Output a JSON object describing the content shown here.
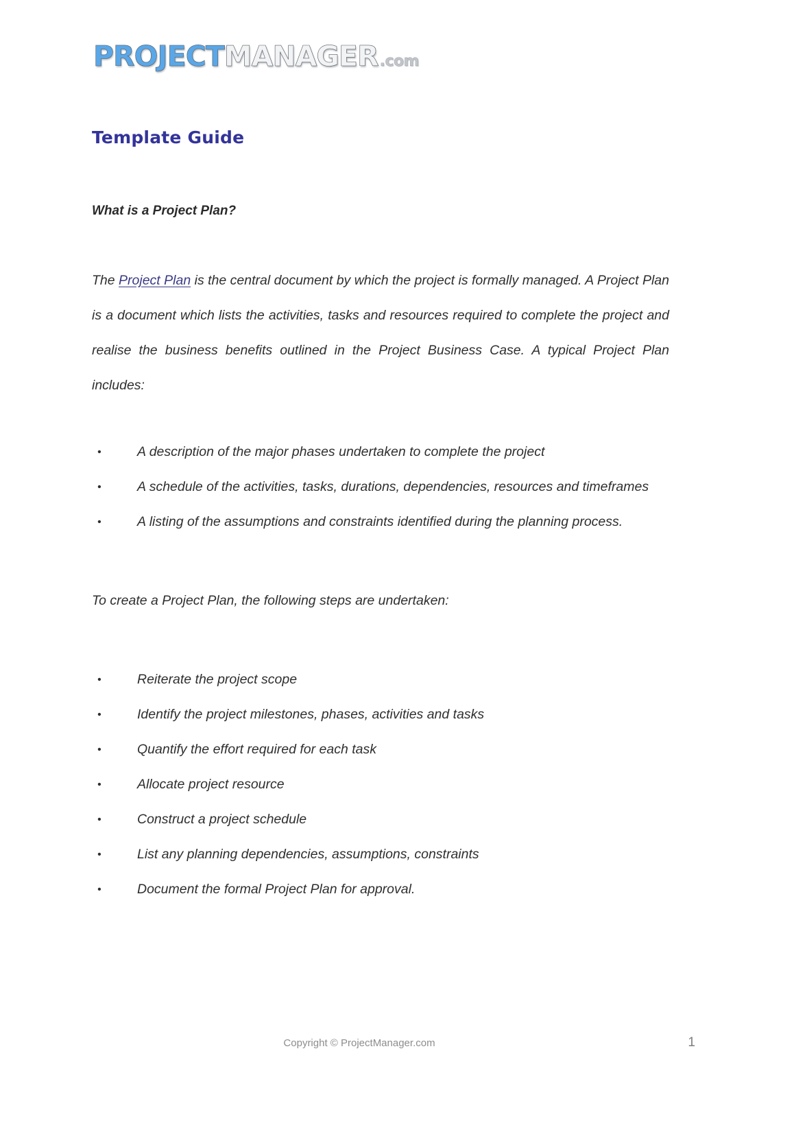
{
  "logo": {
    "part1": "PROJECT",
    "part2": "MANAGER",
    "part3": ".com",
    "color_part1": "#5aa7e8",
    "color_part2": "#e9ebed",
    "color_part3": "#c2c6ca"
  },
  "document": {
    "title": "Template Guide",
    "title_color": "#33339b",
    "section_heading": "What is a Project Plan?",
    "intro_before_link": "The ",
    "intro_link": "Project Plan",
    "intro_after_link": " is the central document by which the project is formally managed. A Project Plan is a document which lists the activities, tasks and resources required to complete the project and realise the business benefits outlined in the Project Business Case. A typical Project Plan includes:",
    "includes_list": [
      "A description of the major phases undertaken to complete the project",
      "A schedule of the activities, tasks, durations, dependencies, resources and timeframes",
      "A listing of the assumptions and constraints identified during the planning process."
    ],
    "steps_intro": "To create a Project Plan, the following steps are undertaken:",
    "steps_list": [
      "Reiterate the project scope",
      "Identify the project milestones, phases, activities and tasks",
      "Quantify the effort required for each task",
      "Allocate project resource",
      "Construct a project schedule",
      "List any planning dependencies, assumptions, constraints",
      "Document the formal Project Plan for approval."
    ],
    "bullet_marker": "•"
  },
  "footer": {
    "copyright": "Copyright © ProjectManager.com",
    "page_number": "1"
  }
}
